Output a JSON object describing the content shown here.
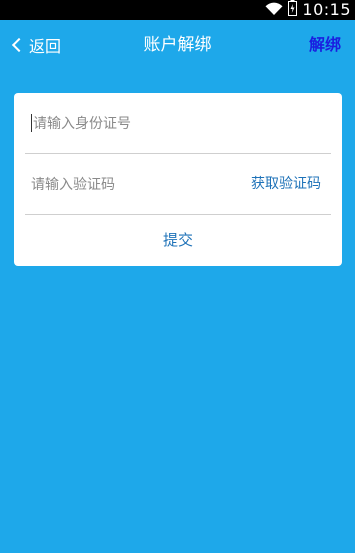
{
  "status_bar": {
    "time": "10:15",
    "icons": [
      "wifi-icon",
      "battery-icon"
    ]
  },
  "nav": {
    "back_label": "返回",
    "title": "账户解绑",
    "action_label": "解绑"
  },
  "form": {
    "id_placeholder": "请输入身份证号",
    "code_placeholder": "请输入验证码",
    "get_code_label": "获取验证码",
    "submit_label": "提交"
  },
  "colors": {
    "background": "#1ea8ea",
    "link_blue": "#1e72b8",
    "action_blue": "#1a1fe0",
    "status_bar": "#000000"
  }
}
